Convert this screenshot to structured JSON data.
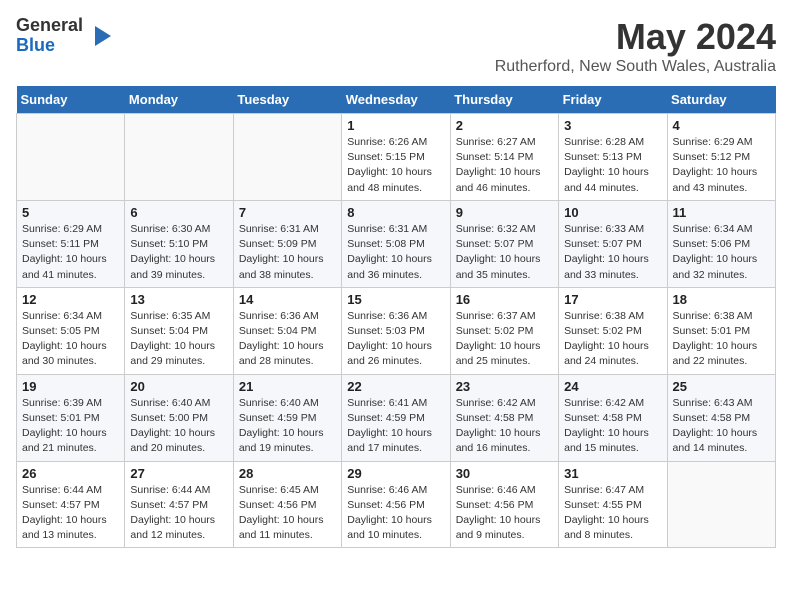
{
  "logo": {
    "general": "General",
    "blue": "Blue"
  },
  "title": "May 2024",
  "subtitle": "Rutherford, New South Wales, Australia",
  "days_of_week": [
    "Sunday",
    "Monday",
    "Tuesday",
    "Wednesday",
    "Thursday",
    "Friday",
    "Saturday"
  ],
  "weeks": [
    [
      {
        "day": "",
        "info": ""
      },
      {
        "day": "",
        "info": ""
      },
      {
        "day": "",
        "info": ""
      },
      {
        "day": "1",
        "info": "Sunrise: 6:26 AM\nSunset: 5:15 PM\nDaylight: 10 hours and 48 minutes."
      },
      {
        "day": "2",
        "info": "Sunrise: 6:27 AM\nSunset: 5:14 PM\nDaylight: 10 hours and 46 minutes."
      },
      {
        "day": "3",
        "info": "Sunrise: 6:28 AM\nSunset: 5:13 PM\nDaylight: 10 hours and 44 minutes."
      },
      {
        "day": "4",
        "info": "Sunrise: 6:29 AM\nSunset: 5:12 PM\nDaylight: 10 hours and 43 minutes."
      }
    ],
    [
      {
        "day": "5",
        "info": "Sunrise: 6:29 AM\nSunset: 5:11 PM\nDaylight: 10 hours and 41 minutes."
      },
      {
        "day": "6",
        "info": "Sunrise: 6:30 AM\nSunset: 5:10 PM\nDaylight: 10 hours and 39 minutes."
      },
      {
        "day": "7",
        "info": "Sunrise: 6:31 AM\nSunset: 5:09 PM\nDaylight: 10 hours and 38 minutes."
      },
      {
        "day": "8",
        "info": "Sunrise: 6:31 AM\nSunset: 5:08 PM\nDaylight: 10 hours and 36 minutes."
      },
      {
        "day": "9",
        "info": "Sunrise: 6:32 AM\nSunset: 5:07 PM\nDaylight: 10 hours and 35 minutes."
      },
      {
        "day": "10",
        "info": "Sunrise: 6:33 AM\nSunset: 5:07 PM\nDaylight: 10 hours and 33 minutes."
      },
      {
        "day": "11",
        "info": "Sunrise: 6:34 AM\nSunset: 5:06 PM\nDaylight: 10 hours and 32 minutes."
      }
    ],
    [
      {
        "day": "12",
        "info": "Sunrise: 6:34 AM\nSunset: 5:05 PM\nDaylight: 10 hours and 30 minutes."
      },
      {
        "day": "13",
        "info": "Sunrise: 6:35 AM\nSunset: 5:04 PM\nDaylight: 10 hours and 29 minutes."
      },
      {
        "day": "14",
        "info": "Sunrise: 6:36 AM\nSunset: 5:04 PM\nDaylight: 10 hours and 28 minutes."
      },
      {
        "day": "15",
        "info": "Sunrise: 6:36 AM\nSunset: 5:03 PM\nDaylight: 10 hours and 26 minutes."
      },
      {
        "day": "16",
        "info": "Sunrise: 6:37 AM\nSunset: 5:02 PM\nDaylight: 10 hours and 25 minutes."
      },
      {
        "day": "17",
        "info": "Sunrise: 6:38 AM\nSunset: 5:02 PM\nDaylight: 10 hours and 24 minutes."
      },
      {
        "day": "18",
        "info": "Sunrise: 6:38 AM\nSunset: 5:01 PM\nDaylight: 10 hours and 22 minutes."
      }
    ],
    [
      {
        "day": "19",
        "info": "Sunrise: 6:39 AM\nSunset: 5:01 PM\nDaylight: 10 hours and 21 minutes."
      },
      {
        "day": "20",
        "info": "Sunrise: 6:40 AM\nSunset: 5:00 PM\nDaylight: 10 hours and 20 minutes."
      },
      {
        "day": "21",
        "info": "Sunrise: 6:40 AM\nSunset: 4:59 PM\nDaylight: 10 hours and 19 minutes."
      },
      {
        "day": "22",
        "info": "Sunrise: 6:41 AM\nSunset: 4:59 PM\nDaylight: 10 hours and 17 minutes."
      },
      {
        "day": "23",
        "info": "Sunrise: 6:42 AM\nSunset: 4:58 PM\nDaylight: 10 hours and 16 minutes."
      },
      {
        "day": "24",
        "info": "Sunrise: 6:42 AM\nSunset: 4:58 PM\nDaylight: 10 hours and 15 minutes."
      },
      {
        "day": "25",
        "info": "Sunrise: 6:43 AM\nSunset: 4:58 PM\nDaylight: 10 hours and 14 minutes."
      }
    ],
    [
      {
        "day": "26",
        "info": "Sunrise: 6:44 AM\nSunset: 4:57 PM\nDaylight: 10 hours and 13 minutes."
      },
      {
        "day": "27",
        "info": "Sunrise: 6:44 AM\nSunset: 4:57 PM\nDaylight: 10 hours and 12 minutes."
      },
      {
        "day": "28",
        "info": "Sunrise: 6:45 AM\nSunset: 4:56 PM\nDaylight: 10 hours and 11 minutes."
      },
      {
        "day": "29",
        "info": "Sunrise: 6:46 AM\nSunset: 4:56 PM\nDaylight: 10 hours and 10 minutes."
      },
      {
        "day": "30",
        "info": "Sunrise: 6:46 AM\nSunset: 4:56 PM\nDaylight: 10 hours and 9 minutes."
      },
      {
        "day": "31",
        "info": "Sunrise: 6:47 AM\nSunset: 4:55 PM\nDaylight: 10 hours and 8 minutes."
      },
      {
        "day": "",
        "info": ""
      }
    ]
  ]
}
